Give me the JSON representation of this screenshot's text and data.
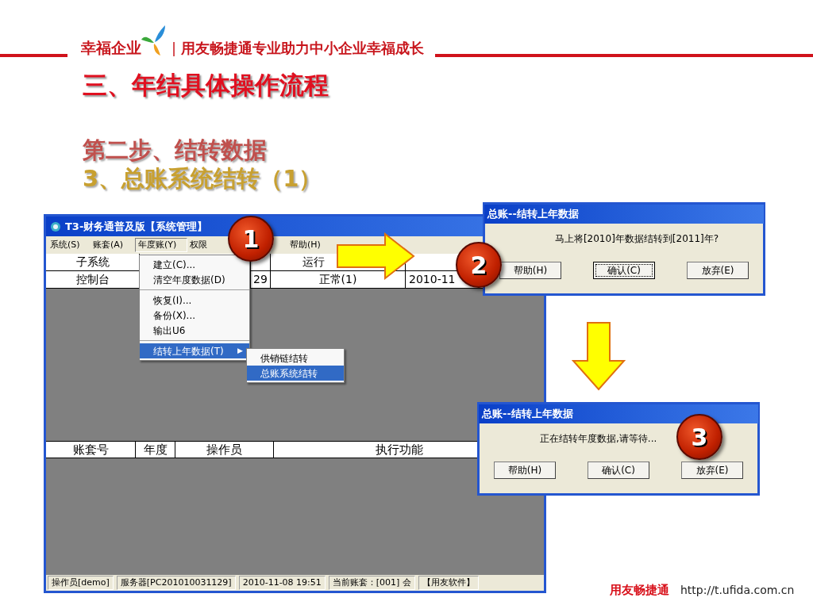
{
  "header": {
    "brand": "幸福企业",
    "divider": "|",
    "tagline": "用友畅捷通专业助力中小企业幸福成长"
  },
  "title": "三、年结具体操作流程",
  "step": "第二步、结转数据",
  "substep": "3、总账系统结转（1）",
  "main_window": {
    "title": "T3-财务通普及版【系统管理】",
    "menu": [
      {
        "label": "系统(S)",
        "selected": false
      },
      {
        "label": "账套(A)",
        "selected": false
      },
      {
        "label": "年度账(Y)",
        "selected": true
      },
      {
        "label": "权限",
        "selected": false
      },
      {
        "label": "帮助(H)",
        "selected": false
      }
    ],
    "top_table": {
      "columns": [
        {
          "header": "子系统",
          "cell": "控制台"
        },
        {
          "cell": "29"
        },
        {
          "header": "运行",
          "cell": "正常(1)"
        },
        {
          "cell": "2010-11"
        }
      ]
    },
    "year_menu": [
      [
        {
          "label": "建立(C)...",
          "selected": false
        },
        {
          "label": "清空年度数据(D)",
          "selected": false
        }
      ],
      [
        {
          "label": "恢复(I)...",
          "selected": false
        },
        {
          "label": "备份(X)...",
          "selected": false
        },
        {
          "label": "输出U6",
          "selected": false
        }
      ],
      [
        {
          "label": "结转上年数据(T)",
          "selected": true,
          "submenu_mark": "▶"
        }
      ]
    ],
    "submenu": [
      {
        "label": "供销链结转",
        "selected": false
      },
      {
        "label": "总账系统结转",
        "selected": true
      }
    ],
    "bottom_table": {
      "header": [
        "账套号",
        "年度",
        "操作员",
        "执行功能"
      ]
    },
    "status_bar": [
      "操作员[demo]",
      "服务器[PC201010031129]",
      "2010-11-08 19:51",
      "当前账套：[001] 会",
      "【用友软件】"
    ]
  },
  "dialogs": [
    {
      "title": "总账--结转上年数据",
      "message": "马上将[2010]年数据结转到[2011]年?",
      "buttons": [
        {
          "label": "帮助(H)",
          "focused": false
        },
        {
          "label": "确认(C)",
          "focused": true
        },
        {
          "label": "放弃(E)",
          "focused": false
        }
      ]
    },
    {
      "title": "总账--结转上年数据",
      "message": "正在结转年度数据,请等待...",
      "buttons": [
        {
          "label": "帮助(H)",
          "focused": false
        },
        {
          "label": "确认(C)",
          "focused": false
        },
        {
          "label": "放弃(E)",
          "focused": false
        }
      ]
    }
  ],
  "badges": [
    "1",
    "2",
    "3"
  ],
  "footer": {
    "brand": "用友畅捷通",
    "url": "http://t.ufida.com.cn"
  }
}
